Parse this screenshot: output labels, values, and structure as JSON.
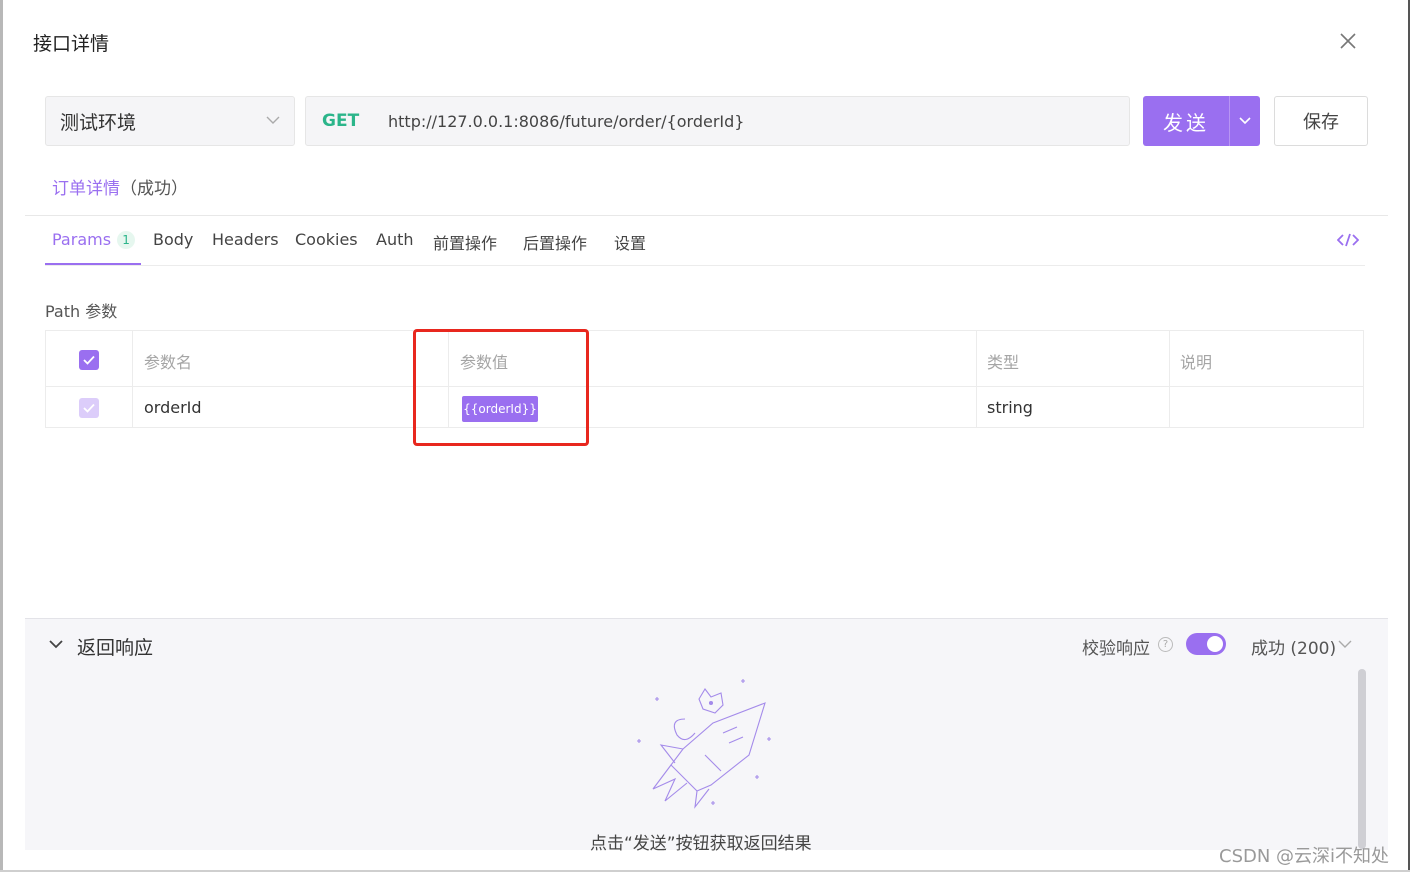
{
  "dialog": {
    "title": "接口详情"
  },
  "request": {
    "environment": "测试环境",
    "method": "GET",
    "url": "http://127.0.0.1:8086/future/order/{orderId}",
    "send_label": "发送",
    "save_label": "保存"
  },
  "api": {
    "name": "订单详情",
    "status": "（成功）"
  },
  "tabs": [
    {
      "label": "Params",
      "badge": "1",
      "active": true
    },
    {
      "label": "Body"
    },
    {
      "label": "Headers"
    },
    {
      "label": "Cookies"
    },
    {
      "label": "Auth"
    },
    {
      "label": "前置操作"
    },
    {
      "label": "后置操作"
    },
    {
      "label": "设置"
    }
  ],
  "path_params": {
    "section_label": "Path 参数",
    "headers": [
      "参数名",
      "参数值",
      "类型",
      "说明"
    ],
    "rows": [
      {
        "name": "orderId",
        "value": "{{orderId}}",
        "type": "string",
        "description": ""
      }
    ]
  },
  "response": {
    "title": "返回响应",
    "verify_label": "校验响应",
    "help": "?",
    "status_option": "成功 (200)",
    "empty_hint": "点击“发送”按钮获取返回结果"
  },
  "colors": {
    "accent": "#9a6ff0",
    "method_get": "#2bb58a",
    "highlight": "#e8271e"
  },
  "watermark": "CSDN @云深i不知处"
}
